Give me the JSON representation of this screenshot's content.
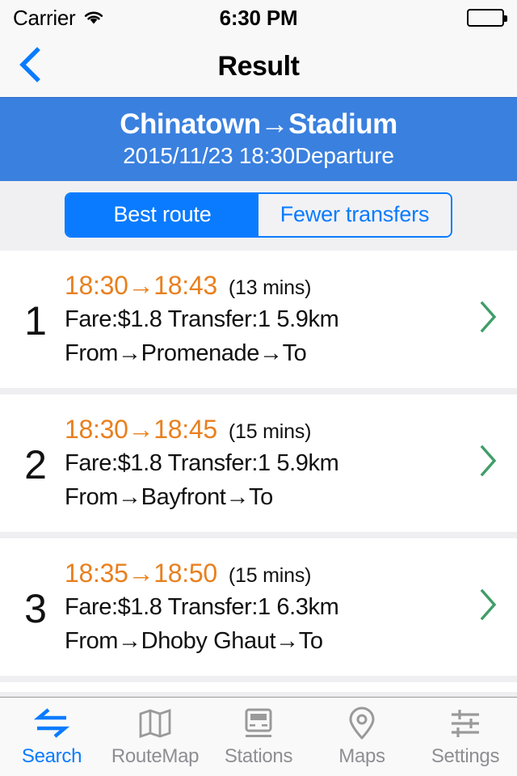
{
  "status_bar": {
    "carrier": "Carrier",
    "wifi_icon": "wifi-icon",
    "time": "6:30 PM",
    "battery_icon": "battery-full-icon"
  },
  "nav_bar": {
    "back_icon": "chevron-left-icon",
    "title": "Result"
  },
  "route_header": {
    "title": "Chinatown→Stadium",
    "subtitle": "2015/11/23 18:30Departure",
    "background_color": "#3a80df"
  },
  "segmented_control": {
    "options": [
      {
        "label": "Best route",
        "selected": true
      },
      {
        "label": "Fewer transfers",
        "selected": false
      }
    ],
    "accent_color": "#0a7bff"
  },
  "results": [
    {
      "index": "1",
      "times": "18:30→18:43",
      "duration": "(13 mins)",
      "details": "Fare:$1.8 Transfer:1  5.9km",
      "path": "From→Promenade→To",
      "chevron_icon": "chevron-right-icon"
    },
    {
      "index": "2",
      "times": "18:30→18:45",
      "duration": "(15 mins)",
      "details": "Fare:$1.8 Transfer:1  5.9km",
      "path": "From→Bayfront→To",
      "chevron_icon": "chevron-right-icon"
    },
    {
      "index": "3",
      "times": "18:35→18:50",
      "duration": "(15 mins)",
      "details": "Fare:$1.8 Transfer:1  6.3km",
      "path": "From→Dhoby Ghaut→To",
      "chevron_icon": "chevron-right-icon"
    }
  ],
  "colors": {
    "time_orange": "#e8801f",
    "chevron_green": "#3f9e68",
    "tab_active": "#0a7bff",
    "tab_inactive": "#8e8e93"
  },
  "tab_bar": {
    "tabs": [
      {
        "label": "Search",
        "icon": "transfer-arrows-icon",
        "active": true
      },
      {
        "label": "RouteMap",
        "icon": "folded-map-icon",
        "active": false
      },
      {
        "label": "Stations",
        "icon": "train-front-icon",
        "active": false
      },
      {
        "label": "Maps",
        "icon": "location-pin-icon",
        "active": false
      },
      {
        "label": "Settings",
        "icon": "sliders-icon",
        "active": false
      }
    ]
  }
}
